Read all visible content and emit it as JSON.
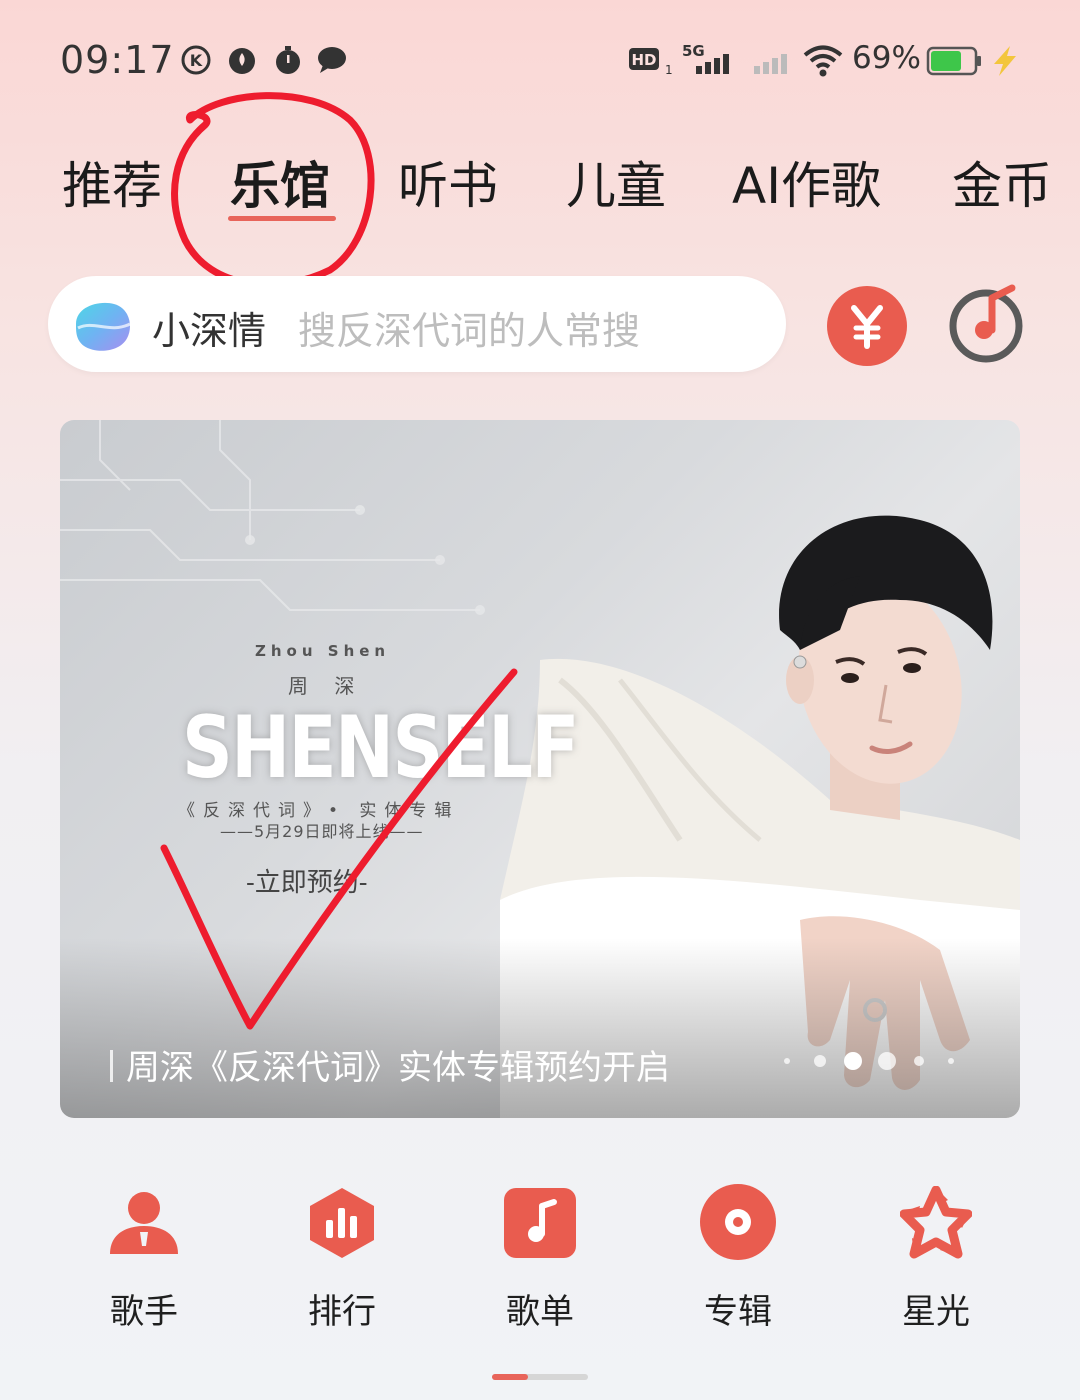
{
  "status_bar": {
    "time": "09:17",
    "left_icons": [
      "k-circle-icon",
      "flame-icon",
      "timer-icon",
      "chat-bubble-icon"
    ],
    "hd_label": "HD",
    "network_label": "5G",
    "battery_percent": "69%",
    "battery_level": 0.69
  },
  "tabs": [
    {
      "label": "推荐",
      "active": false
    },
    {
      "label": "乐馆",
      "active": true
    },
    {
      "label": "听书",
      "active": false
    },
    {
      "label": "儿童",
      "active": false
    },
    {
      "label": "AI作歌",
      "active": false
    },
    {
      "label": "金币",
      "active": false
    }
  ],
  "search": {
    "brand": "小深情",
    "placeholder": "搜反深代词的人常搜"
  },
  "banner": {
    "album_latin": "Zhou Shen",
    "album_artist_cn": "周 深",
    "album_logo": "SHENSELF",
    "album_subtitle": "《反深代词》• 实体专辑",
    "album_date": "——5月29日即将上线——",
    "album_cta": "-立即预约-",
    "caption": "周深《反深代词》实体专辑预约开启",
    "page_count": 6,
    "active_page": 2
  },
  "quick_nav": [
    {
      "label": "歌手",
      "icon": "singer-icon"
    },
    {
      "label": "排行",
      "icon": "chart-rank-icon"
    },
    {
      "label": "歌单",
      "icon": "playlist-icon"
    },
    {
      "label": "专辑",
      "icon": "album-disc-icon"
    },
    {
      "label": "星光",
      "icon": "starlight-icon"
    }
  ],
  "colors": {
    "accent": "#e8645a",
    "icon_red": "#e95c4f"
  }
}
